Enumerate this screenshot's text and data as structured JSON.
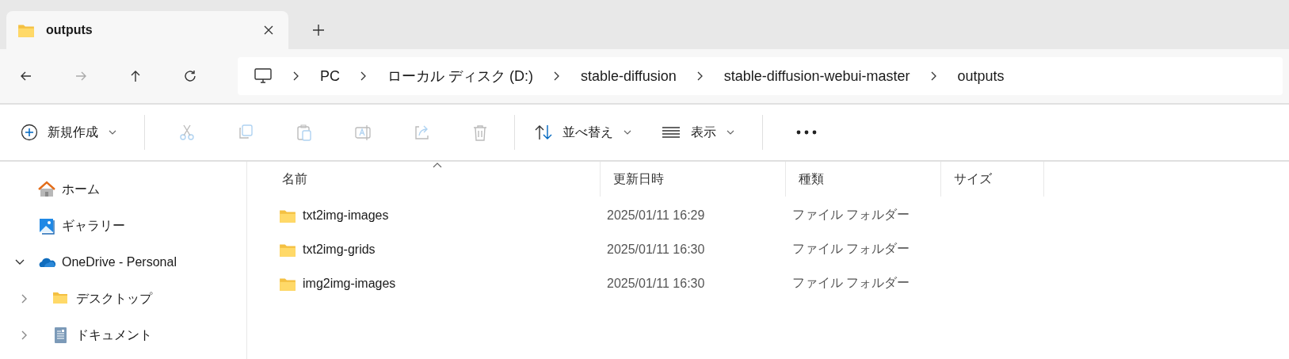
{
  "tabs": [
    {
      "label": "outputs",
      "selected": true
    }
  ],
  "address": {
    "segments": [
      "PC",
      "ローカル ディスク (D:)",
      "stable-diffusion",
      "stable-diffusion-webui-master",
      "outputs"
    ]
  },
  "toolbar": {
    "new_label": "新規作成",
    "sort_label": "並べ替え",
    "view_label": "表示",
    "actions": [
      {
        "kind": "cut",
        "disabled": true
      },
      {
        "kind": "copy",
        "disabled": true
      },
      {
        "kind": "paste",
        "disabled": true
      },
      {
        "kind": "rename",
        "disabled": true
      },
      {
        "kind": "share",
        "disabled": true
      },
      {
        "kind": "delete",
        "disabled": true
      }
    ]
  },
  "sidebar": {
    "items": [
      {
        "label": "ホーム",
        "kind": "home"
      },
      {
        "label": "ギャラリー",
        "kind": "gallery"
      },
      {
        "label": "OneDrive - Personal",
        "kind": "cloud",
        "expanded": true,
        "children": [
          {
            "label": "デスクトップ",
            "kind": "folder",
            "expanded": false
          },
          {
            "label": "ドキュメント",
            "kind": "document",
            "expanded": false
          }
        ]
      }
    ]
  },
  "table": {
    "columns": [
      "名前",
      "更新日時",
      "種類",
      "サイズ"
    ],
    "rows": [
      {
        "name": "txt2img-images",
        "modified": "2025/01/11 16:29",
        "type": "ファイル フォルダー"
      },
      {
        "name": "txt2img-grids",
        "modified": "2025/01/11 16:30",
        "type": "ファイル フォルダー"
      },
      {
        "name": "img2img-images",
        "modified": "2025/01/11 16:30",
        "type": "ファイル フォルダー"
      }
    ]
  }
}
